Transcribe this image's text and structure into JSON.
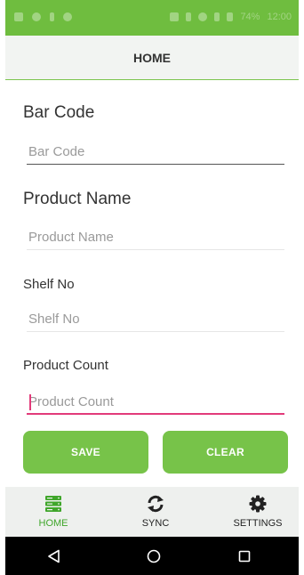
{
  "status_bar": {
    "battery": "74%",
    "time": "12:00"
  },
  "app_bar": {
    "title": "HOME"
  },
  "form": {
    "bar_code": {
      "label": "Bar Code",
      "value": "",
      "placeholder": "Bar Code"
    },
    "product_name": {
      "label": "Product Name",
      "value": "",
      "placeholder": "Product Name"
    },
    "shelf_no": {
      "label": "Shelf No",
      "value": "",
      "placeholder": "Shelf No"
    },
    "product_count": {
      "label": "Product Count",
      "value": "",
      "placeholder": "Product Count"
    }
  },
  "buttons": {
    "save": "SAVE",
    "clear": "CLEAR"
  },
  "tabs": [
    {
      "label": "HOME",
      "icon": "server-icon",
      "active": true
    },
    {
      "label": "SYNC",
      "icon": "sync-icon",
      "active": false
    },
    {
      "label": "SETTINGS",
      "icon": "gear-icon",
      "active": false
    }
  ],
  "colors": {
    "accent_green": "#77c349",
    "status_green": "#6fbd3f",
    "focus_pink": "#e23b7a",
    "active_tab": "#3fa62a"
  }
}
